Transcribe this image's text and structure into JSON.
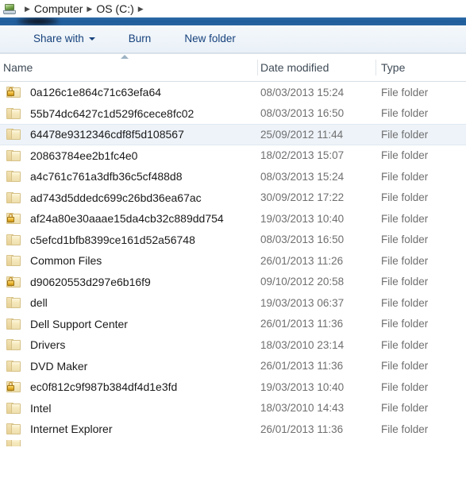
{
  "window": {
    "app": "Windows Explorer"
  },
  "address_bar": {
    "icon": "computer-icon",
    "separator": "▶",
    "crumbs": [
      {
        "label": "Computer"
      },
      {
        "label": "OS (C:)"
      }
    ]
  },
  "toolbar": {
    "share_with_label": "Share with",
    "share_with_caret": "chevron-down-icon",
    "burn_label": "Burn",
    "new_folder_label": "New folder"
  },
  "columns": {
    "name": "Name",
    "date_modified": "Date modified",
    "type": "Type",
    "sort_column": "Name",
    "sort_direction": "ascending"
  },
  "colors": {
    "accent_blue": "#1f5d9b",
    "toolbar_text": "#16417c",
    "selection": "#eef3f9",
    "folder_yellow": "#f6e9bd",
    "secondary_text": "#6f6f6f"
  },
  "files": [
    {
      "name": "0a126c1e864c71c63efa64",
      "date": "08/03/2013 15:24",
      "type": "File folder",
      "locked": true,
      "selected": false
    },
    {
      "name": "55b74dc6427c1d529f6cece8fc02",
      "date": "08/03/2013 16:50",
      "type": "File folder",
      "locked": false,
      "selected": false
    },
    {
      "name": "64478e9312346cdf8f5d108567",
      "date": "25/09/2012 11:44",
      "type": "File folder",
      "locked": false,
      "selected": true
    },
    {
      "name": "20863784ee2b1fc4e0",
      "date": "18/02/2013 15:07",
      "type": "File folder",
      "locked": false,
      "selected": false
    },
    {
      "name": "a4c761c761a3dfb36c5cf488d8",
      "date": "08/03/2013 15:24",
      "type": "File folder",
      "locked": false,
      "selected": false
    },
    {
      "name": "ad743d5ddedc699c26bd36ea67ac",
      "date": "30/09/2012 17:22",
      "type": "File folder",
      "locked": false,
      "selected": false
    },
    {
      "name": "af24a80e30aaae15da4cb32c889dd754",
      "date": "19/03/2013 10:40",
      "type": "File folder",
      "locked": true,
      "selected": false
    },
    {
      "name": "c5efcd1bfb8399ce161d52a56748",
      "date": "08/03/2013 16:50",
      "type": "File folder",
      "locked": false,
      "selected": false
    },
    {
      "name": "Common Files",
      "date": "26/01/2013 11:26",
      "type": "File folder",
      "locked": false,
      "selected": false
    },
    {
      "name": "d90620553d297e6b16f9",
      "date": "09/10/2012 20:58",
      "type": "File folder",
      "locked": true,
      "selected": false
    },
    {
      "name": "dell",
      "date": "19/03/2013 06:37",
      "type": "File folder",
      "locked": false,
      "selected": false
    },
    {
      "name": "Dell Support Center",
      "date": "26/01/2013 11:36",
      "type": "File folder",
      "locked": false,
      "selected": false
    },
    {
      "name": "Drivers",
      "date": "18/03/2010 23:14",
      "type": "File folder",
      "locked": false,
      "selected": false
    },
    {
      "name": "DVD Maker",
      "date": "26/01/2013 11:36",
      "type": "File folder",
      "locked": false,
      "selected": false
    },
    {
      "name": "ec0f812c9f987b384df4d1e3fd",
      "date": "19/03/2013 10:40",
      "type": "File folder",
      "locked": true,
      "selected": false
    },
    {
      "name": "Intel",
      "date": "18/03/2010 14:43",
      "type": "File folder",
      "locked": false,
      "selected": false
    },
    {
      "name": "Internet Explorer",
      "date": "26/01/2013 11:36",
      "type": "File folder",
      "locked": false,
      "selected": false
    }
  ]
}
